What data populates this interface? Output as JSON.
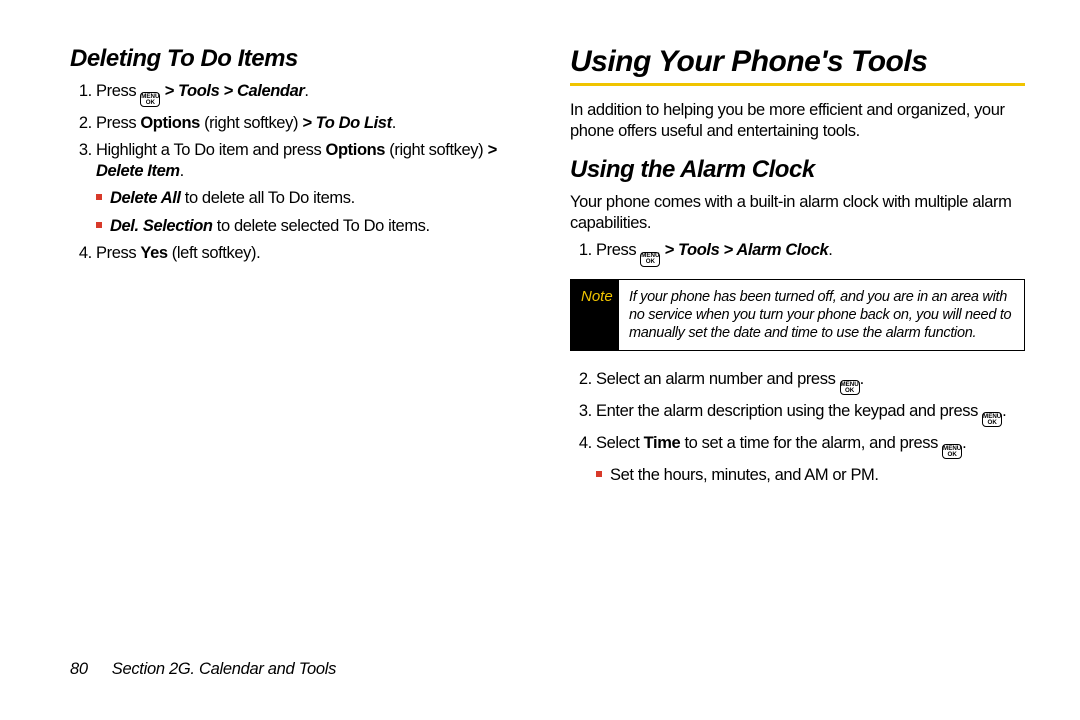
{
  "left": {
    "heading": "Deleting To Do Items",
    "steps": {
      "s1a": "Press ",
      "s1b": " > ",
      "s1c": "Tools",
      "s1d": " > ",
      "s1e": "Calendar",
      "s1f": ".",
      "s2a": "Press ",
      "s2b": "Options",
      "s2c": " (right softkey) ",
      "s2d": "> ",
      "s2e": "To Do List",
      "s2f": ".",
      "s3a": "Highlight a To Do item and press ",
      "s3b": "Options",
      "s3c": " (right softkey) ",
      "s3d": "> ",
      "s3e": "Delete Item",
      "s3f": ".",
      "b1a": "Delete All",
      "b1b": " to delete all To Do items.",
      "b2a": "Del. Selection",
      "b2b": " to delete selected To Do items.",
      "s4a": "Press ",
      "s4b": "Yes",
      "s4c": " (left softkey)."
    }
  },
  "right": {
    "heading_main": "Using Your Phone's Tools",
    "intro": "In addition to helping you be more efficient and organized, your phone offers useful and entertaining tools.",
    "heading_sub": "Using the Alarm Clock",
    "intro2": "Your phone comes with a built-in alarm clock with multiple alarm capabilities.",
    "steps": {
      "s1a": "Press ",
      "s1b": " > ",
      "s1c": "Tools",
      "s1d": " > ",
      "s1e": "Alarm Clock",
      "s1f": ".",
      "s2a": "Select an alarm number and press ",
      "s2b": ".",
      "s3a": "Enter the alarm description using the keypad and press ",
      "s3b": ".",
      "s4a": "Select ",
      "s4b": "Time",
      "s4c": " to set a time for the alarm, and press ",
      "s4d": ".",
      "b1": "Set the hours, minutes, and AM or PM."
    },
    "note": {
      "label": "Note",
      "text": "If your phone has been turned off, and you are in an area with no service when you turn your phone back on, you will need to manually set the date and time to use the alarm function."
    }
  },
  "key": {
    "top": "MENU",
    "bottom": "OK"
  },
  "footer": {
    "page": "80",
    "section": "Section 2G. Calendar and Tools"
  }
}
